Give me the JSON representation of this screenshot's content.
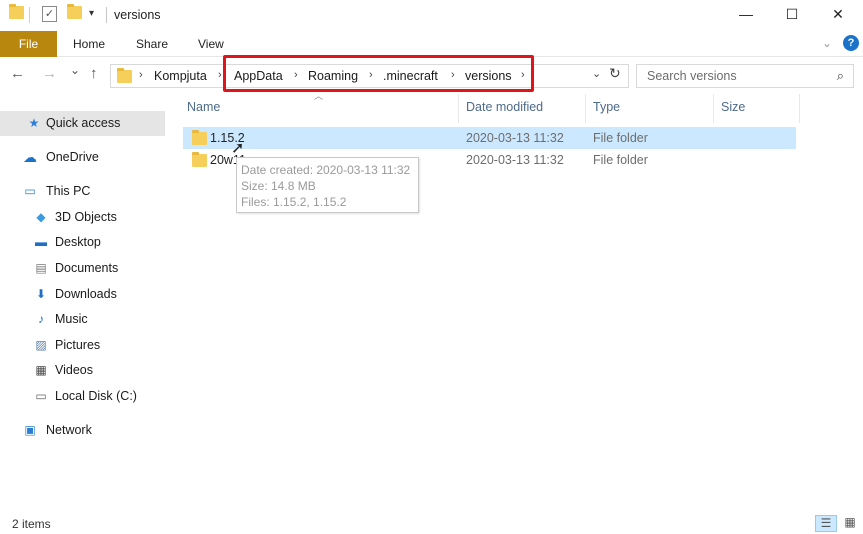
{
  "window": {
    "title": "versions"
  },
  "titlebar_icons": [
    "folder-icon",
    "checkbox-icon",
    "folder-icon",
    "dropdown-icon"
  ],
  "window_buttons": {
    "minimize": "—",
    "maximize": "☐",
    "close": "✕"
  },
  "ribbon": {
    "tabs": [
      "File",
      "Home",
      "Share",
      "View"
    ],
    "file_tab_color": "#b8880e"
  },
  "nav": {
    "back": "←",
    "forward": "→",
    "recent": "⌄",
    "up": "↑",
    "breadcrumbs": [
      "Kompjuta",
      "AppData",
      "Roaming",
      ".minecraft",
      "versions"
    ],
    "separator": "›",
    "search_placeholder": "Search versions",
    "highlight_color": "#e0151b"
  },
  "sidebar": {
    "items": [
      {
        "label": "Quick access",
        "icon": "star-icon",
        "selected": true
      },
      {
        "label": "OneDrive",
        "icon": "cloud-icon"
      },
      {
        "label": "This PC",
        "icon": "computer-icon"
      },
      {
        "label": "3D Objects",
        "icon": "cube-icon"
      },
      {
        "label": "Desktop",
        "icon": "desktop-icon"
      },
      {
        "label": "Documents",
        "icon": "document-icon"
      },
      {
        "label": "Downloads",
        "icon": "download-icon"
      },
      {
        "label": "Music",
        "icon": "music-icon"
      },
      {
        "label": "Pictures",
        "icon": "picture-icon"
      },
      {
        "label": "Videos",
        "icon": "video-icon"
      },
      {
        "label": "Local Disk (C:)",
        "icon": "disk-icon"
      },
      {
        "label": "Network",
        "icon": "network-icon"
      }
    ]
  },
  "columns": [
    "Name",
    "Date modified",
    "Type",
    "Size"
  ],
  "files": [
    {
      "name": "1.15.2",
      "date": "2020-03-13 11:32",
      "type": "File folder",
      "size": "",
      "selected": true
    },
    {
      "name": "20w11a",
      "date": "2020-03-13 11:32",
      "type": "File folder",
      "size": ""
    }
  ],
  "tooltip": {
    "date_created": "Date created: 2020-03-13 11:32",
    "size": "Size: 14.8 MB",
    "files": "Files: 1.15.2, 1.15.2"
  },
  "status": {
    "items": "2 items"
  }
}
